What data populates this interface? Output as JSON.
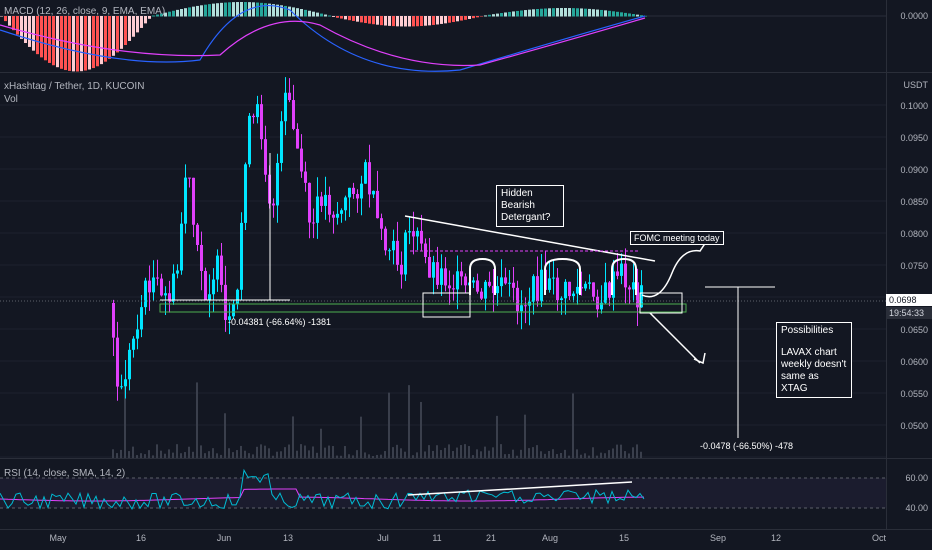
{
  "macd": {
    "legend": "MACD (12, 26, close, 9, EMA, EMA)",
    "axis_label": "0.0000",
    "colors": {
      "hist_up": "#26a69a",
      "hist_up_light": "#b2dfdb",
      "hist_down": "#ff5252",
      "hist_down_light": "#ffcdd2",
      "macd": "#2962ff",
      "signal": "#ff6d00"
    }
  },
  "main": {
    "symbol": "xHashtag / Tether, 1D, KUCOIN",
    "vol_label": "Vol",
    "currency": "USDT",
    "price_ticks": [
      "0.1000",
      "0.0950",
      "0.0900",
      "0.0850",
      "0.0800",
      "0.0750",
      "0.0650",
      "0.0600",
      "0.0550",
      "0.0500"
    ],
    "last_price": "0.0698",
    "countdown": "19:54:33",
    "measure_low": "-0.04381 (-66.64%) -1381",
    "measure_right": "-0.0478 (-66.50%) -478",
    "annotations": {
      "hidden_bearish": "Hidden Bearish Detergant?",
      "fomc": "FOMC meeting today",
      "possibilities_title": "Possibilities",
      "possibilities_body": "LAVAX chart weekly doesn't same as XTAG"
    },
    "colors": {
      "up": "#00e5ff",
      "down": "#e040fb",
      "line": "#ffffff",
      "box": "#4caf50"
    }
  },
  "rsi": {
    "legend": "RSI (14, close, SMA, 14, 2)",
    "ticks": [
      "60.00",
      "40.00"
    ],
    "colors": {
      "rsi": "#00bcd4",
      "ma": "#e040fb"
    }
  },
  "time_axis": [
    "May",
    "16",
    "Jun",
    "13",
    "Jul",
    "11",
    "21",
    "Aug",
    "15",
    "Sep",
    "12",
    "Oct"
  ]
}
